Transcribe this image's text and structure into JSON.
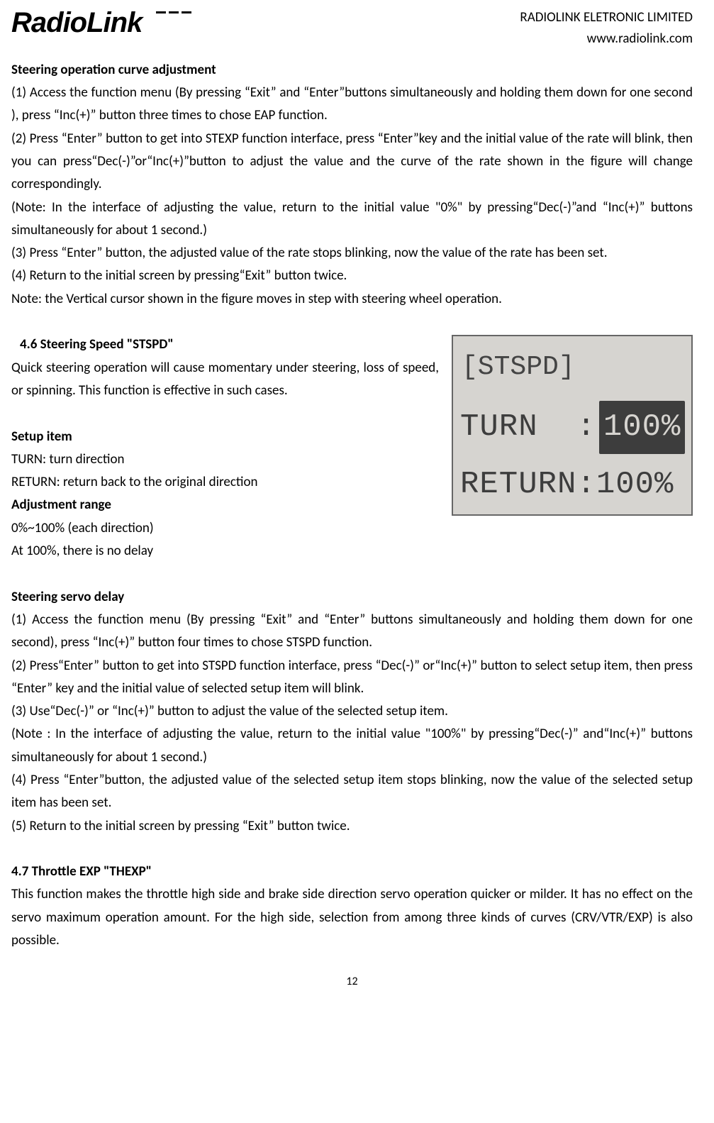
{
  "header": {
    "logo": "RadioLink",
    "company": "RADIOLINK ELETRONIC LIMITED",
    "website": "www.radiolink.com"
  },
  "section1": {
    "title": "Steering operation curve adjustment",
    "p1": "(1) Access the function menu (By pressing  “Exit”  and  “Enter”buttons simultaneously and holding them down for one second ), press  “Inc(+)”  button three times to chose EAP function.",
    "p2": "(2) Press  “Enter” button to get into STEXP function interface, press  “Enter”key and the initial value of the rate will blink, then you can press“Dec(-)”or“Inc(+)”button to adjust the value and the curve of the rate shown in the figure will change correspondingly.",
    "p3": "(Note: In the interface of adjusting the value, return to the initial value \"0%\" by pressing“Dec(-)”and “Inc(+)”  buttons simultaneously for about 1 second.)",
    "p4": "(3) Press  “Enter”  button, the adjusted value of the rate stops blinking, now the value of the rate has been set.",
    "p5": "(4) Return to the initial screen by pressing“Exit”  button twice.",
    "p6": "Note: the Vertical cursor shown in the figure moves in step with steering wheel operation."
  },
  "section2": {
    "title": "4.6 Steering Speed \"STSPD\"",
    "intro": "Quick steering operation will cause momentary under steering, loss of speed, or spinning. This function is effective in such cases.",
    "setup_label": "Setup item",
    "turn": "TURN: turn direction",
    "return": "RETURN: return back to the original direction",
    "adj_label": "Adjustment range",
    "adj1": "0%~100% (each direction)",
    "adj2": "At 100%, there is no delay"
  },
  "display": {
    "title": "[STSPD]",
    "turn_label": "TURN  :",
    "turn_value": "100%",
    "return_label": "RETURN:",
    "return_value": " 100%"
  },
  "section3": {
    "title": "Steering servo delay",
    "p1": "(1) Access the function menu (By pressing  “Exit” and “Enter”  buttons simultaneously and holding them down for one second), press  “Inc(+)”  button four times to chose STSPD function.",
    "p2": "(2) Press“Enter”  button to get into STSPD function interface, press  “Dec(-)”  or“Inc(+)”  button to select setup item, then press  “Enter”  key and the initial value of selected setup item will blink.",
    "p3": "(3) Use“Dec(-)”  or  “Inc(+)”  button to adjust the value of the selected setup item.",
    "p4": "(Note : In the interface of adjusting the value, return to the initial value \"100%\" by pressing“Dec(-)” and“Inc(+)”  buttons simultaneously for about 1 second.)",
    "p5": "(4) Press  “Enter”button, the adjusted value of the selected setup item stops blinking, now the value of the selected setup item has been set.",
    "p6": "(5) Return to the initial screen by pressing  “Exit”  button twice."
  },
  "section4": {
    "title": "4.7 Throttle EXP \"THEXP\"",
    "p1": "This function makes the throttle high side and brake side direction servo operation quicker or milder. It has no effect on the servo maximum operation amount. For the high side, selection from among three kinds of curves (CRV/VTR/EXP) is also possible."
  },
  "page_number": "12"
}
